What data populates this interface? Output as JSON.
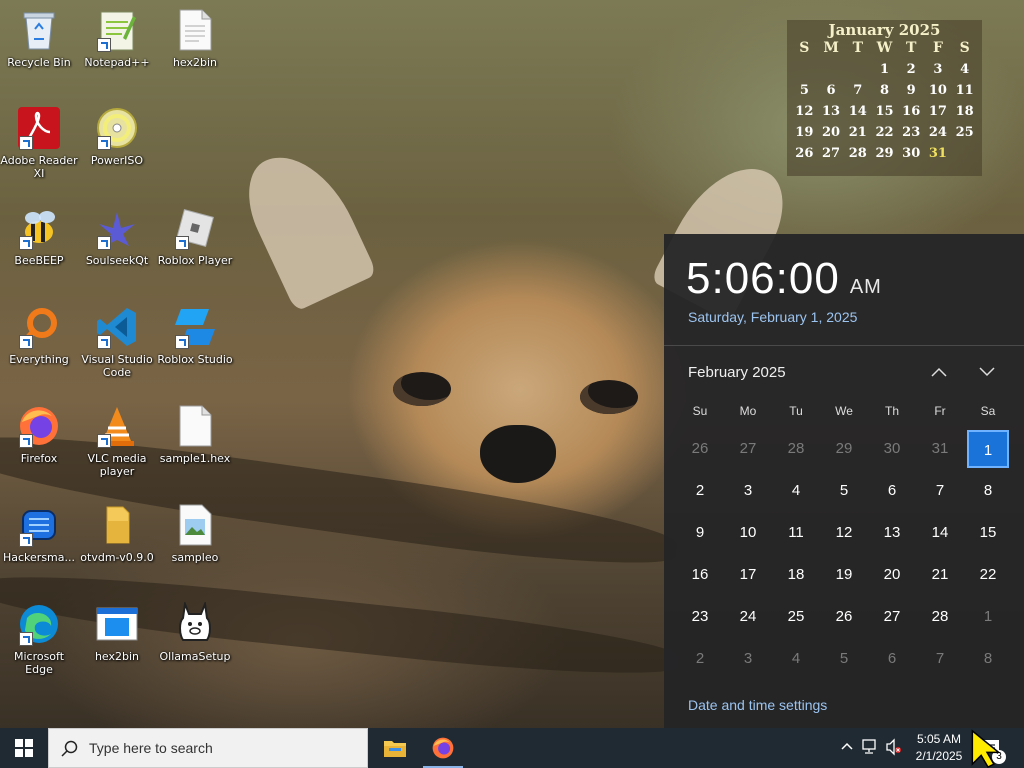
{
  "desktop": {
    "icons": [
      {
        "label": "Recycle Bin"
      },
      {
        "label": "Notepad++"
      },
      {
        "label": "hex2bin"
      },
      {
        "label": "Adobe Reader XI"
      },
      {
        "label": "PowerISO"
      },
      {
        "label": "BeeBEEP"
      },
      {
        "label": "SoulseekQt"
      },
      {
        "label": "Roblox Player"
      },
      {
        "label": "Everything"
      },
      {
        "label": "Visual Studio Code"
      },
      {
        "label": "Roblox Studio"
      },
      {
        "label": "Firefox"
      },
      {
        "label": "VLC media player"
      },
      {
        "label": "sample1.hex"
      },
      {
        "label": "Hackersma..."
      },
      {
        "label": "otvdm-v0.9.0"
      },
      {
        "label": "sampleo"
      },
      {
        "label": "Microsoft Edge"
      },
      {
        "label": "hex2bin"
      },
      {
        "label": "OllamaSetup"
      }
    ]
  },
  "mini_calendar": {
    "title": "January 2025",
    "headers": [
      "S",
      "M",
      "T",
      "W",
      "T",
      "F",
      "S"
    ],
    "rows": [
      [
        "",
        "",
        "",
        "1",
        "2",
        "3",
        "4"
      ],
      [
        "5",
        "6",
        "7",
        "8",
        "9",
        "10",
        "11"
      ],
      [
        "12",
        "13",
        "14",
        "15",
        "16",
        "17",
        "18"
      ],
      [
        "19",
        "20",
        "21",
        "22",
        "23",
        "24",
        "25"
      ],
      [
        "26",
        "27",
        "28",
        "29",
        "30",
        "31",
        ""
      ]
    ],
    "highlight": "31"
  },
  "flyout": {
    "time": "5:06:00",
    "ampm": "AM",
    "date": "Saturday, February 1, 2025",
    "month_label": "February 2025",
    "weekdays": [
      "Su",
      "Mo",
      "Tu",
      "We",
      "Th",
      "Fr",
      "Sa"
    ],
    "days": [
      {
        "d": "26",
        "dim": true
      },
      {
        "d": "27",
        "dim": true
      },
      {
        "d": "28",
        "dim": true
      },
      {
        "d": "29",
        "dim": true
      },
      {
        "d": "30",
        "dim": true
      },
      {
        "d": "31",
        "dim": true
      },
      {
        "d": "1",
        "sel": true
      },
      {
        "d": "2"
      },
      {
        "d": "3"
      },
      {
        "d": "4"
      },
      {
        "d": "5"
      },
      {
        "d": "6"
      },
      {
        "d": "7"
      },
      {
        "d": "8"
      },
      {
        "d": "9"
      },
      {
        "d": "10"
      },
      {
        "d": "11"
      },
      {
        "d": "12"
      },
      {
        "d": "13"
      },
      {
        "d": "14"
      },
      {
        "d": "15"
      },
      {
        "d": "16"
      },
      {
        "d": "17"
      },
      {
        "d": "18"
      },
      {
        "d": "19"
      },
      {
        "d": "20"
      },
      {
        "d": "21"
      },
      {
        "d": "22"
      },
      {
        "d": "23"
      },
      {
        "d": "24"
      },
      {
        "d": "25"
      },
      {
        "d": "26"
      },
      {
        "d": "27"
      },
      {
        "d": "28"
      },
      {
        "d": "1",
        "dim": true
      },
      {
        "d": "2",
        "dim": true
      },
      {
        "d": "3",
        "dim": true
      },
      {
        "d": "4",
        "dim": true
      },
      {
        "d": "5",
        "dim": true
      },
      {
        "d": "6",
        "dim": true
      },
      {
        "d": "7",
        "dim": true
      },
      {
        "d": "8",
        "dim": true
      }
    ],
    "settings_link": "Date and time settings"
  },
  "taskbar": {
    "search_placeholder": "Type here to search",
    "clock_time": "5:05 AM",
    "clock_date": "2/1/2025",
    "notification_count": "3"
  },
  "colors": {
    "accent": "#1a73d9",
    "link": "#9bc4f0",
    "taskbar": "#1f2a33"
  }
}
